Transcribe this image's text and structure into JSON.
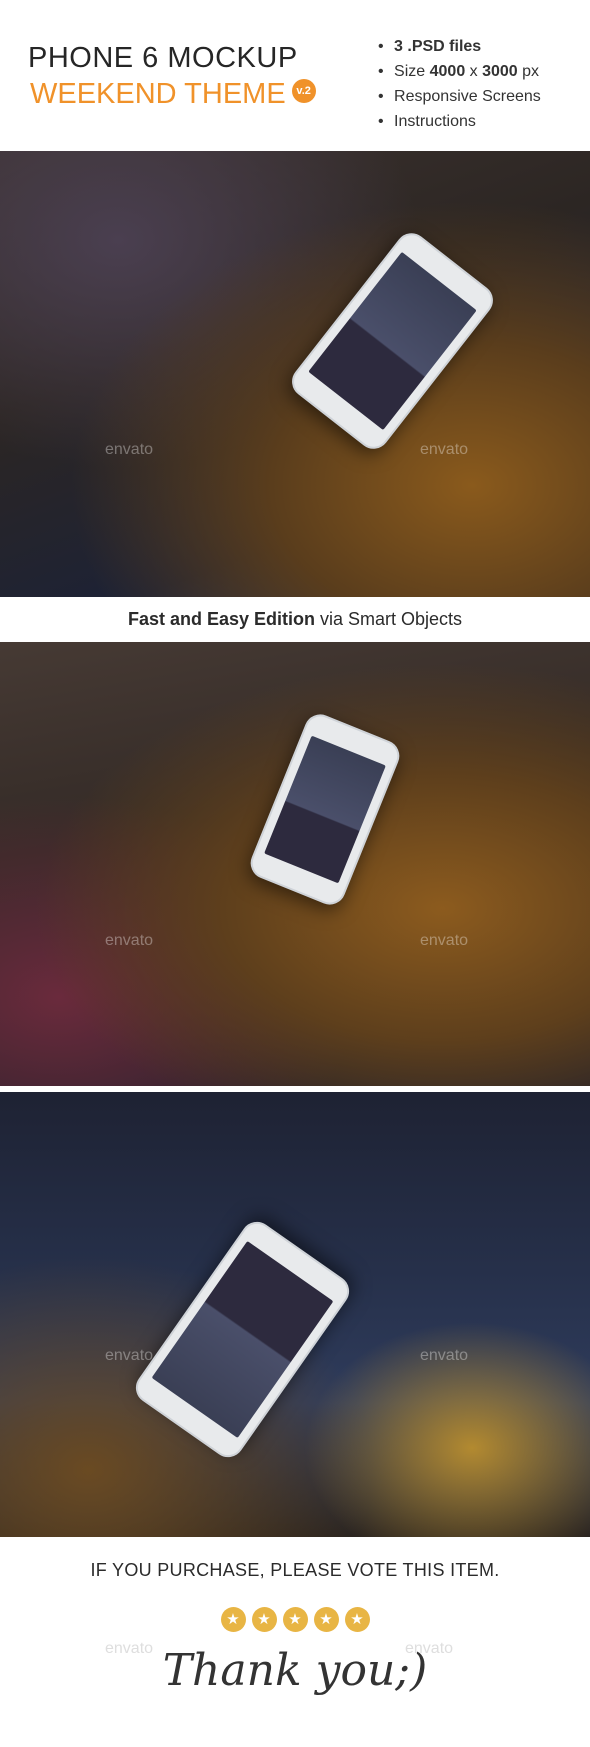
{
  "header": {
    "title": "PHONE 6 MOCKUP",
    "subtitle": "WEEKEND THEME",
    "version": "v.2",
    "accent": "#f0922a",
    "features": [
      {
        "bold": "3 .PSD files",
        "pre": "",
        "post": ""
      },
      {
        "pre": "Size ",
        "bold": "4000",
        "mid": " x ",
        "bold2": "3000",
        "post": " px"
      },
      {
        "pre": "Responsive Screens"
      },
      {
        "pre": "Instructions"
      }
    ]
  },
  "band": {
    "bold": "Fast and Easy Edition",
    "rest": " via Smart Objects"
  },
  "watermark": "envato",
  "footer": {
    "vote": "IF YOU PURCHASE, PLEASE VOTE THIS ITEM.",
    "rating": 5,
    "star_color": "#e8b544",
    "thanks": "Thank you;)"
  }
}
